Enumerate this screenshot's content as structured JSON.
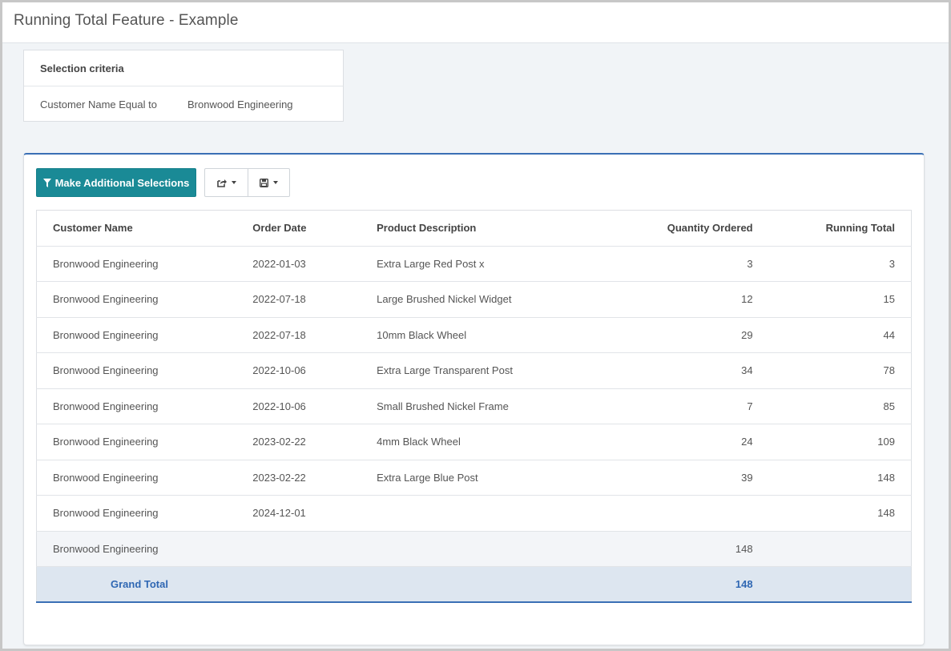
{
  "page": {
    "title": "Running Total Feature - Example"
  },
  "criteria": {
    "heading": "Selection criteria",
    "field": "Customer Name Equal to",
    "value": "Bronwood Engineering"
  },
  "toolbar": {
    "selections_label": "Make Additional Selections",
    "icons": [
      "filter-icon",
      "share-icon",
      "save-icon"
    ]
  },
  "table": {
    "headers": [
      "Customer Name",
      "Order Date",
      "Product Description",
      "Quantity Ordered",
      "Running Total"
    ],
    "rows": [
      [
        "Bronwood Engineering",
        "2022-01-03",
        "Extra Large Red Post x",
        "3",
        "3"
      ],
      [
        "Bronwood Engineering",
        "2022-07-18",
        "Large Brushed Nickel Widget",
        "12",
        "15"
      ],
      [
        "Bronwood Engineering",
        "2022-07-18",
        "10mm Black Wheel",
        "29",
        "44"
      ],
      [
        "Bronwood Engineering",
        "2022-10-06",
        "Extra Large Transparent Post",
        "34",
        "78"
      ],
      [
        "Bronwood Engineering",
        "2022-10-06",
        "Small Brushed Nickel Frame",
        "7",
        "85"
      ],
      [
        "Bronwood Engineering",
        "2023-02-22",
        "4mm Black Wheel",
        "24",
        "109"
      ],
      [
        "Bronwood Engineering",
        "2023-02-22",
        "Extra Large Blue Post",
        "39",
        "148"
      ],
      [
        "Bronwood Engineering",
        "2024-12-01",
        "",
        "",
        "148"
      ]
    ],
    "subtotal": {
      "customer": "Bronwood Engineering",
      "quantity": "148"
    },
    "grand_total": {
      "label": "Grand Total",
      "quantity": "148"
    }
  },
  "colors": {
    "accent": "#1a8a96",
    "highlight": "#2f67b3",
    "grand_bg": "#dde6f0"
  }
}
